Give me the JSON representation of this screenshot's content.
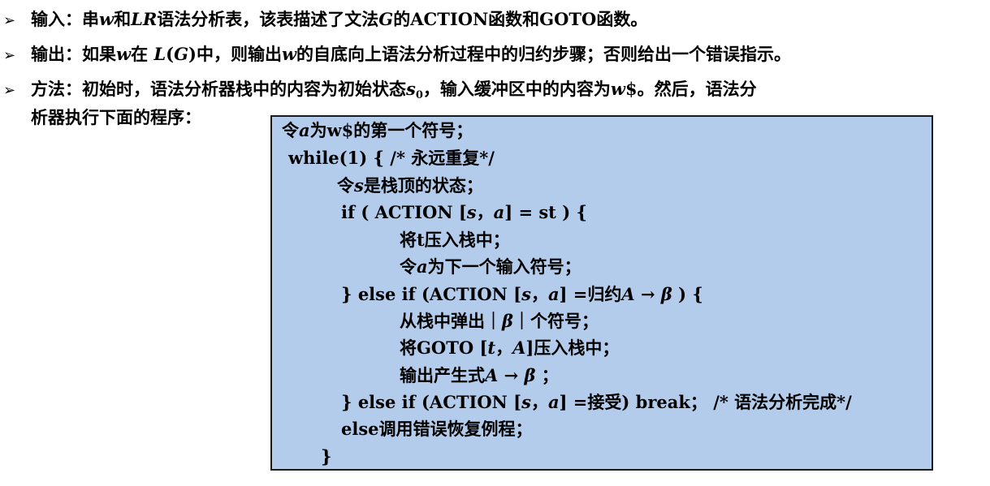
{
  "bullets": {
    "marker": "➢",
    "b1": {
      "label": "输入：",
      "t1": "串",
      "w": "w",
      "t2": "和",
      "lr": "LR",
      "t3": "语法分析表，该表描述了文法",
      "g": "G",
      "t4": "的ACTION函数和GOTO函数。"
    },
    "b2": {
      "label": "输出：",
      "t1": "如果",
      "w": "w",
      "t2": "在 ",
      "l": "L",
      "lp": "(",
      "g": "G",
      "rp": ")",
      "t3": "中，则输出",
      "w2": "w",
      "t4": "的自底向上语法分析过程中的归约步骤；否则给出一个错误指示。"
    },
    "b3": {
      "label": "方法：",
      "t1": "初始时，语法分析器栈中的内容为初始状态",
      "s": "s",
      "sub": "0",
      "t2": "，输入缓冲区中的内容为",
      "w": "w",
      "t3": "$。然后，语法分",
      "cont": "析器执行下面的程序："
    }
  },
  "code": {
    "l0": {
      "a": "令",
      "v": "a",
      "b": "为w$的第一个符号；"
    },
    "l1": "while(1) { /* 永远重复*/",
    "l2": {
      "a": "令",
      "v": "s",
      "b": "是栈顶的状态；"
    },
    "l3": {
      "a": "if ( ACTION [",
      "v1": "s",
      "b": "，",
      "v2": "a",
      "c": "] = st ) {"
    },
    "l4": "将t压入栈中；",
    "l5": {
      "a": "令",
      "v": "a",
      "b": "为下一个输入符号；"
    },
    "l6": {
      "a": "} else  if (ACTION [",
      "v1": "s",
      "b": "，",
      "v2": "a",
      "c": "] =归约",
      "v3": "A",
      "d": " → ",
      "v4": "β",
      "e": " ) {"
    },
    "l7": {
      "a": "从栈中弹出｜",
      "v": "β",
      "b": "｜个符号；"
    },
    "l8": {
      "a": "将GOTO [",
      "v1": "t",
      "b": "，",
      "v2": "A",
      "c": "]压入栈中；"
    },
    "l9": {
      "a": "输出产生式",
      "v1": "A",
      "b": " → ",
      "v2": "β",
      "c": " ；"
    },
    "l10": {
      "a": "} else  if (ACTION [",
      "v1": "s",
      "b": "，",
      "v2": "a",
      "c": "] =接受) break；  /* 语法分析完成*/"
    },
    "l11": "else调用错误恢复例程；",
    "l12": "}"
  }
}
